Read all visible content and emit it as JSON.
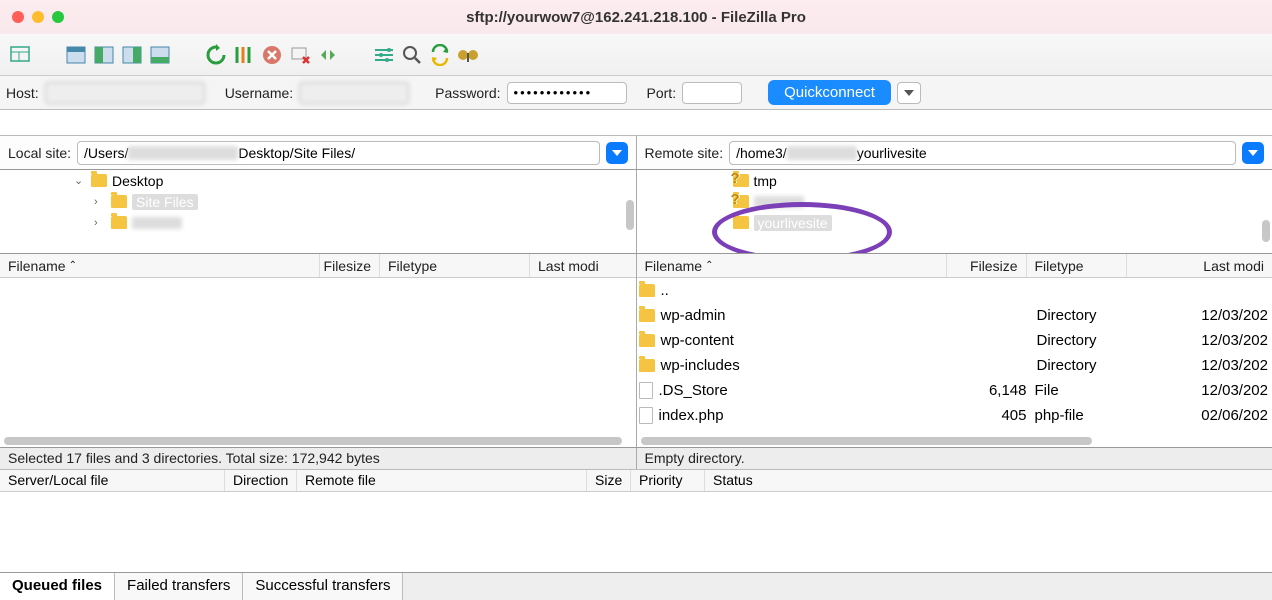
{
  "title": "sftp://yourwow7@162.241.218.100 - FileZilla Pro",
  "quickconnect": {
    "host_label": "Host:",
    "username_label": "Username:",
    "password_label": "Password:",
    "password_value": "••••••••••••",
    "port_label": "Port:",
    "button": "Quickconnect"
  },
  "local": {
    "label": "Local site:",
    "path_prefix": "/Users/",
    "path_suffix": "Desktop/Site Files/",
    "tree": {
      "desktop": "Desktop",
      "sitefiles": "Site Files"
    },
    "columns": {
      "filename": "Filename",
      "filesize": "Filesize",
      "filetype": "Filetype",
      "modified": "Last modi"
    },
    "status": "Selected 17 files and 3 directories. Total size: 172,942 bytes"
  },
  "remote": {
    "label": "Remote site:",
    "path_prefix": "/home3/",
    "path_suffix": "yourlivesite",
    "tree": {
      "tmp": "tmp",
      "yourlivesite": "yourlivesite"
    },
    "columns": {
      "filename": "Filename",
      "filesize": "Filesize",
      "filetype": "Filetype",
      "modified": "Last modi"
    },
    "files": [
      {
        "name": "..",
        "size": "",
        "type": "",
        "modified": "",
        "kind": "folder"
      },
      {
        "name": "wp-admin",
        "size": "",
        "type": "Directory",
        "modified": "12/03/202",
        "kind": "folder"
      },
      {
        "name": "wp-content",
        "size": "",
        "type": "Directory",
        "modified": "12/03/202",
        "kind": "folder"
      },
      {
        "name": "wp-includes",
        "size": "",
        "type": "Directory",
        "modified": "12/03/202",
        "kind": "folder"
      },
      {
        "name": ".DS_Store",
        "size": "6,148",
        "type": "File",
        "modified": "12/03/202",
        "kind": "file"
      },
      {
        "name": "index.php",
        "size": "405",
        "type": "php-file",
        "modified": "02/06/202",
        "kind": "file"
      }
    ],
    "status": "Empty directory."
  },
  "queue": {
    "columns": {
      "server": "Server/Local file",
      "direction": "Direction",
      "remote": "Remote file",
      "size": "Size",
      "priority": "Priority",
      "status": "Status"
    }
  },
  "tabs": {
    "queued": "Queued files",
    "failed": "Failed transfers",
    "successful": "Successful transfers"
  },
  "icons": {
    "sitemanager": "sitemanager",
    "toggle1": "t1",
    "toggle2": "t2",
    "toggle3": "t3",
    "toggle4": "t4",
    "refresh": "refresh",
    "processing": "proc",
    "cancel": "cancel",
    "disconnect": "disc",
    "reconnect": "reconn",
    "filter": "filter",
    "search": "search",
    "sync": "sync",
    "compare": "compare"
  }
}
